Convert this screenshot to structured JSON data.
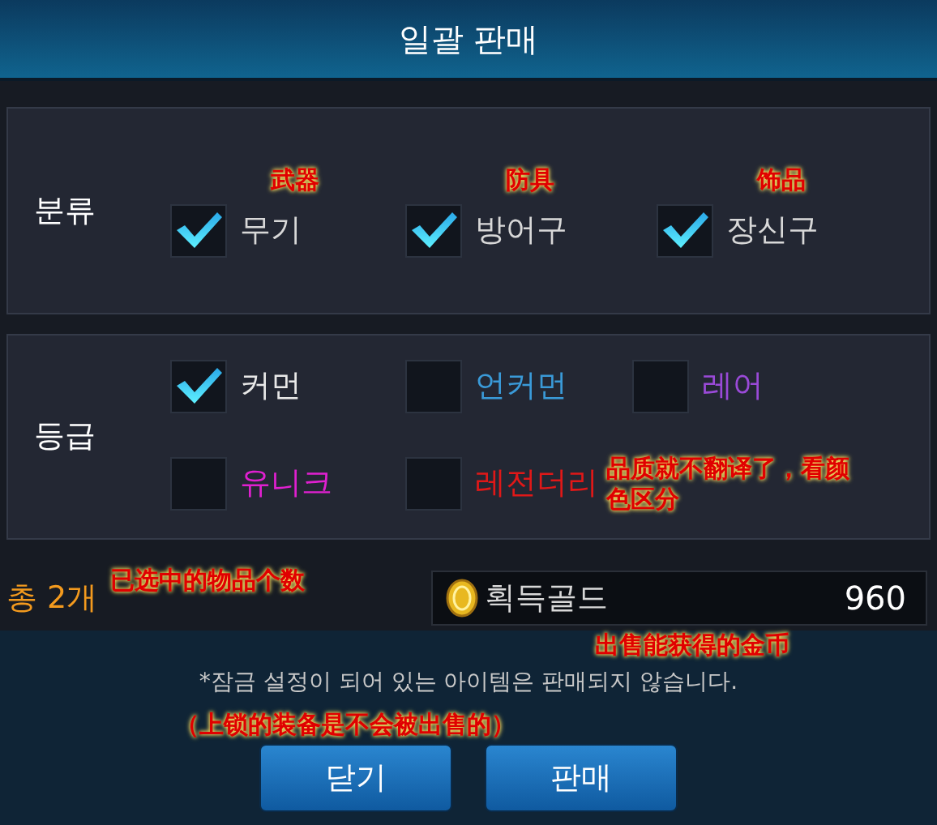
{
  "window": {
    "title": "일괄 판매"
  },
  "category": {
    "label": "분류",
    "items": [
      {
        "label": "무기",
        "checked": true,
        "note": "武器"
      },
      {
        "label": "방어구",
        "checked": true,
        "note": "防具"
      },
      {
        "label": "장신구",
        "checked": true,
        "note": "饰品"
      }
    ]
  },
  "grade": {
    "label": "등급",
    "items": [
      {
        "label": "커먼",
        "checked": true,
        "color": "#e8e8e8"
      },
      {
        "label": "언커먼",
        "checked": false,
        "color": "#3a9ad8"
      },
      {
        "label": "레어",
        "checked": false,
        "color": "#9a4ad8"
      },
      {
        "label": "유니크",
        "checked": false,
        "color": "#e020d0"
      },
      {
        "label": "레전더리",
        "checked": false,
        "color": "#e01818"
      }
    ],
    "note": "品质就不翻译了，看颜色区分"
  },
  "total": {
    "text": "총 2개",
    "note": "已选中的物品个数"
  },
  "gold": {
    "label": "획득골드",
    "value": "960",
    "note": "出售能获得的金币"
  },
  "notice": {
    "text": "*잠금 설정이 되어 있는 아이템은 판매되지 않습니다.",
    "note": "（上锁的装备是不会被出售的）"
  },
  "buttons": [
    "닫기",
    "판매"
  ]
}
